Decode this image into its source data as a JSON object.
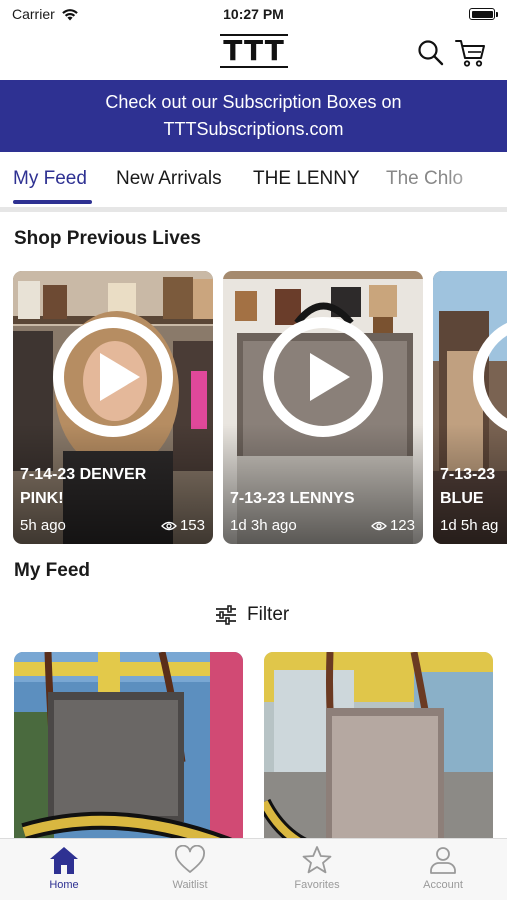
{
  "status_bar": {
    "carrier": "Carrier",
    "time": "10:27 PM"
  },
  "header": {
    "logo": "TTT",
    "search_icon": "search-icon",
    "cart_icon": "cart-icon"
  },
  "banner": {
    "line1": "Check out our Subscription Boxes on",
    "line2": "TTTSubscriptions.com"
  },
  "tabs": [
    {
      "label": "My Feed",
      "active": true
    },
    {
      "label": "New Arrivals",
      "active": false
    },
    {
      "label": "THE LENNY",
      "active": false
    },
    {
      "label": "The Chlo",
      "active": false
    }
  ],
  "previous_lives": {
    "title": "Shop Previous Lives",
    "items": [
      {
        "title_line1": "7-14-23 DENVER",
        "title_line2": "PINK!",
        "time_ago": "5h ago",
        "views": "153"
      },
      {
        "title_line1": "7-13-23 LENNYS",
        "title_line2": "",
        "time_ago": "1d 3h ago",
        "views": "123"
      },
      {
        "title_line1": "7-13-23",
        "title_line2": "BLUE",
        "time_ago": "1d 5h ag",
        "views": ""
      }
    ]
  },
  "feed": {
    "title": "My Feed",
    "filter_label": "Filter"
  },
  "bottom_nav": [
    {
      "label": "Home",
      "icon": "home-icon",
      "active": true
    },
    {
      "label": "Waitlist",
      "icon": "heart-icon",
      "active": false
    },
    {
      "label": "Favorites",
      "icon": "star-icon",
      "active": false
    },
    {
      "label": "Account",
      "icon": "person-icon",
      "active": false
    }
  ],
  "colors": {
    "brand": "#2e3192",
    "inactive": "#9a9a9a"
  }
}
